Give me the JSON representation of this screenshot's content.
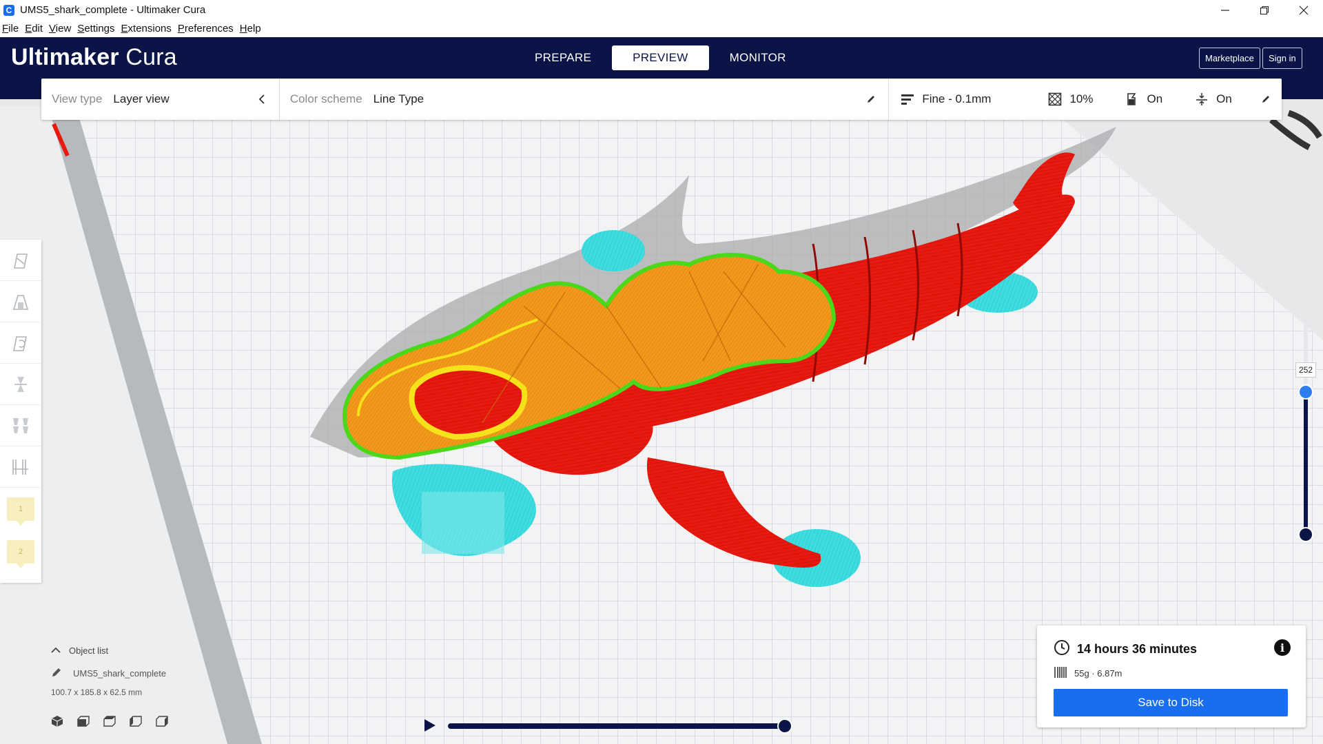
{
  "window": {
    "title": "UMS5_shark_complete - Ultimaker Cura",
    "app_icon_glyph": "C"
  },
  "menu": [
    "File",
    "Edit",
    "View",
    "Settings",
    "Extensions",
    "Preferences",
    "Help"
  ],
  "header": {
    "logo_bold": "Ultimaker",
    "logo_light": "Cura",
    "tabs": [
      {
        "label": "PREPARE",
        "active": false
      },
      {
        "label": "PREVIEW",
        "active": true
      },
      {
        "label": "MONITOR",
        "active": false
      }
    ],
    "marketplace_label": "Marketplace",
    "signin_label": "Sign in",
    "bg_color": "#0a1446"
  },
  "settings_bar": {
    "view_type_label": "View type",
    "view_type_value": "Layer view",
    "color_scheme_label": "Color scheme",
    "color_scheme_value": "Line Type",
    "profile": "Fine - 0.1mm",
    "infill": "10%",
    "support": "On",
    "adhesion": "On"
  },
  "left_toolbar": {
    "tools": [
      "move-tool-icon",
      "scale-tool-icon",
      "rotate-tool-icon",
      "mirror-tool-icon",
      "per-model-settings-icon",
      "support-blocker-icon"
    ],
    "extension_badges": [
      "1",
      "2"
    ]
  },
  "object_list": {
    "header": "Object list",
    "object_name": "UMS5_shark_complete",
    "dimensions": "100.7 x 185.8 x 62.5 mm"
  },
  "layer_slider": {
    "current_layer": "252"
  },
  "print_info": {
    "time": "14 hours 36 minutes",
    "material": "55g · 6.87m",
    "save_label": "Save to Disk",
    "accent_color": "#196ef0"
  }
}
